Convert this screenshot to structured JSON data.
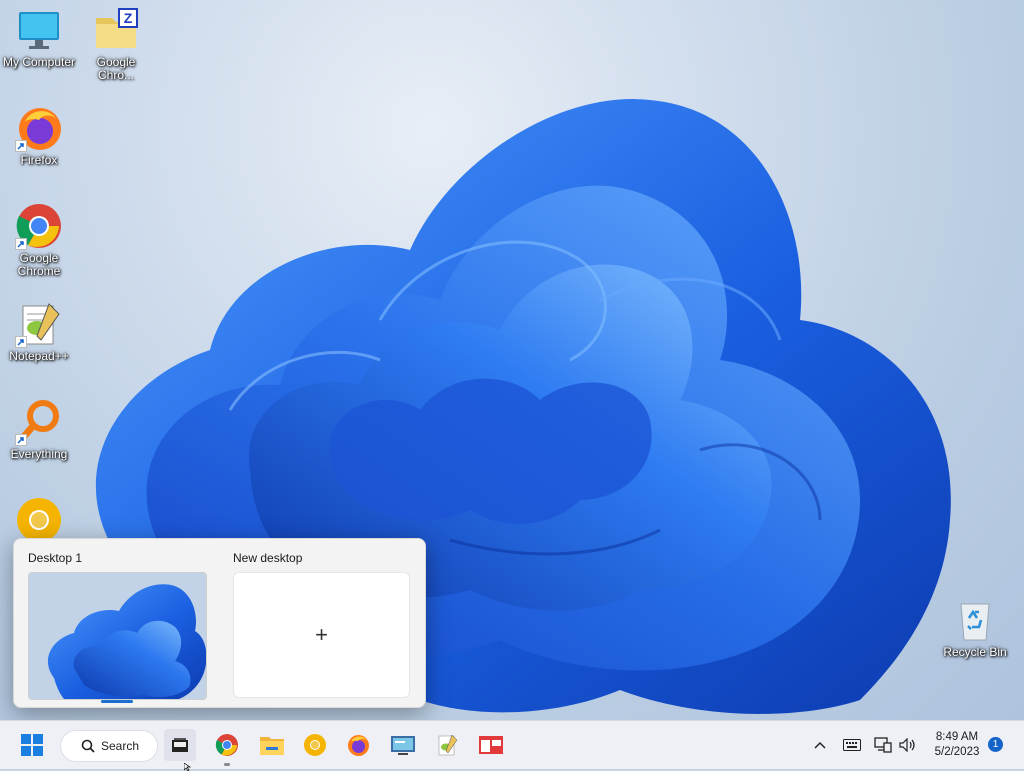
{
  "desktop": {
    "icons": [
      {
        "name": "my-computer",
        "label": "My Computer"
      },
      {
        "name": "google-chrome-folder",
        "label": "Google Chro..."
      },
      {
        "name": "firefox",
        "label": "Firefox"
      },
      {
        "name": "google-chrome",
        "label": "Google Chrome"
      },
      {
        "name": "notepadpp",
        "label": "Notepad++"
      },
      {
        "name": "everything",
        "label": "Everything"
      },
      {
        "name": "recycle-bin",
        "label": "Recycle Bin"
      }
    ]
  },
  "task_view": {
    "desktops": [
      {
        "label": "Desktop 1"
      },
      {
        "label": "New desktop",
        "action_symbol": "+"
      }
    ]
  },
  "taskbar": {
    "search_label": "Search",
    "apps": [
      "start-icon",
      "search-icon",
      "task-view-icon",
      "chrome-icon",
      "file-explorer-icon",
      "chrome-canary-icon",
      "firefox-icon",
      "remote-desktop-icon",
      "notepadpp-icon",
      "snipping-tool-icon"
    ],
    "tray": [
      "chevron-up-icon",
      "keyboard-icon",
      "network-icon",
      "volume-icon"
    ],
    "clock": {
      "time": "8:49 AM",
      "date": "5/2/2023"
    },
    "notification_count": "1"
  },
  "colors": {
    "accent": "#1463c8",
    "bloom": "#1a5fe0",
    "taskbar": "#eef0f6"
  }
}
